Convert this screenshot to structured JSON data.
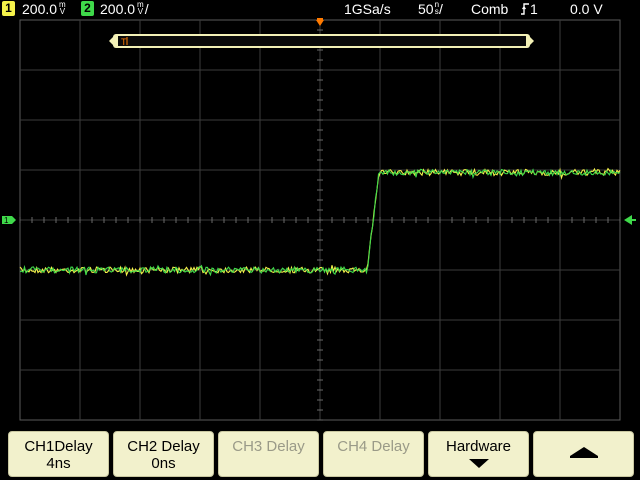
{
  "status": {
    "ch1_num": "1",
    "ch1_scale": "200.0",
    "ch1_unit_top": "m",
    "ch1_unit_bottom": "V",
    "ch2_num": "2",
    "ch2_scale": "200.0",
    "ch2_unit_top": "m",
    "ch2_unit_bottom": "V",
    "sample_rate": "1GSa/s",
    "timebase": "50",
    "timebase_unit_top": "n",
    "timebase_unit_bottom": "s",
    "mode": "Comb",
    "trigger_edge_icon": "rising-edge-icon",
    "trigger_source": "1",
    "trigger_level": "0.0 V",
    "ch1_color": "#f5f24a",
    "ch2_color": "#3fd94a"
  },
  "scope": {
    "grid_divisions_x": 10,
    "grid_divisions_y": 8,
    "delay_ruler_label": "T",
    "ground_marker_label": "1",
    "trigger_marker_icon": "trigger-position-icon",
    "trigger_level_arrow_icon": "left-arrow-icon"
  },
  "softkeys": [
    {
      "label": "CH1Delay",
      "value": "4ns",
      "enabled": true
    },
    {
      "label": "CH2 Delay",
      "value": "0ns",
      "enabled": true
    },
    {
      "label": "CH3 Delay",
      "value": "",
      "enabled": false
    },
    {
      "label": "CH4 Delay",
      "value": "",
      "enabled": false
    },
    {
      "label": "Hardware",
      "value": "",
      "icon": "down-arrow-icon",
      "enabled": true
    },
    {
      "label": "",
      "value": "",
      "icon": "up-arrow-icon",
      "enabled": true
    }
  ],
  "chart_data": {
    "type": "line",
    "xlabel": "",
    "ylabel": "",
    "x_divisions": [
      0,
      10
    ],
    "y_divisions": [
      -4,
      4
    ],
    "series": [
      {
        "channel": "1",
        "color": "#f5f24a",
        "low_div": -1.0,
        "high_div": 0.95,
        "edge_div": 5.95,
        "rise_div": 0.2
      },
      {
        "channel": "2",
        "color": "#3fd94a",
        "low_div": -1.0,
        "high_div": 0.95,
        "edge_div": 5.95,
        "rise_div": 0.2
      }
    ]
  }
}
